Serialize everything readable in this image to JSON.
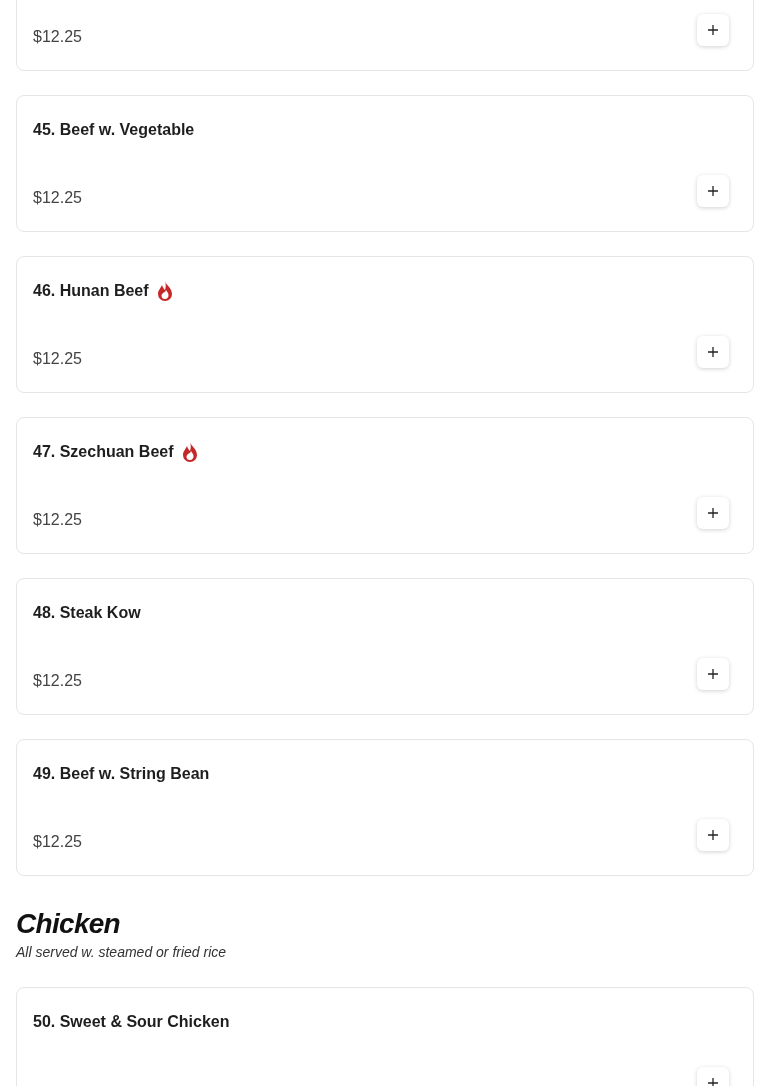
{
  "sections": [
    {
      "items": [
        {
          "price": "$12.25"
        },
        {
          "name": "45. Beef w. Vegetable",
          "price": "$12.25",
          "spicy": false
        },
        {
          "name": "46. Hunan Beef",
          "price": "$12.25",
          "spicy": true
        },
        {
          "name": "47. Szechuan Beef",
          "price": "$12.25",
          "spicy": true
        },
        {
          "name": "48. Steak Kow",
          "price": "$12.25",
          "spicy": false
        },
        {
          "name": "49. Beef w. String Bean",
          "price": "$12.25",
          "spicy": false
        }
      ]
    },
    {
      "title": "Chicken",
      "subtitle": "All served w. steamed or fried rice",
      "items": [
        {
          "name": "50. Sweet & Sour Chicken",
          "spicy": false
        }
      ]
    }
  ]
}
